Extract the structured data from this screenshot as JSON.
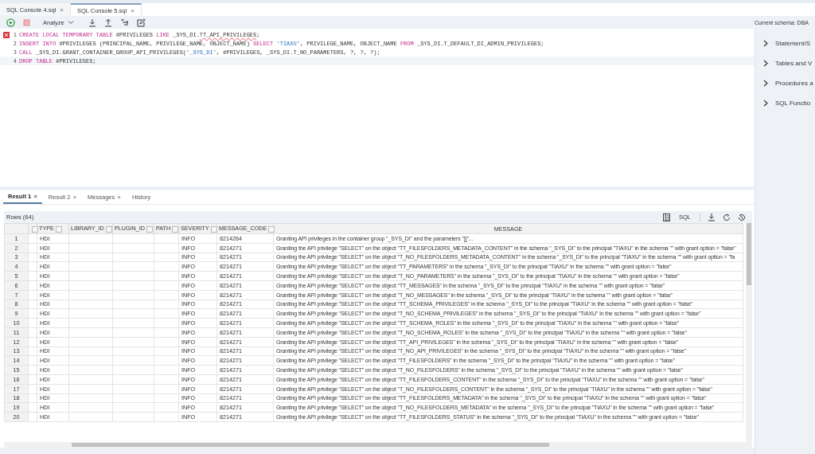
{
  "editor_tabs": [
    {
      "label": "SQL Console 4.sql",
      "close": "×",
      "selected": false
    },
    {
      "label": "SQL Console 5.sql",
      "close": "×",
      "selected": true
    }
  ],
  "toolbar": {
    "analyze": "Analyze",
    "current_schema": "Current schema: DBA"
  },
  "code_lines": [
    {
      "number": "1",
      "error": true,
      "current": false,
      "tokens": [
        {
          "kind": "keyword",
          "text": "CREATE LOCAL TEMPORARY TABLE"
        },
        {
          "kind": "text",
          "text": " #PRIVILEGES "
        },
        {
          "kind": "keyword",
          "text": "LIKE"
        },
        {
          "kind": "text",
          "text": " _SYS_DI."
        },
        {
          "kind": "flagged",
          "text": "TT_API_PRIVILEGES"
        },
        {
          "kind": "text",
          "text": ";"
        }
      ]
    },
    {
      "number": "2",
      "error": false,
      "current": false,
      "tokens": [
        {
          "kind": "keyword",
          "text": "INSERT INTO"
        },
        {
          "kind": "text",
          "text": " #PRIVILEGES (PRINCIPAL_NAME, PRIVILEGE_NAME, OBJECT_NAME) "
        },
        {
          "kind": "keyword",
          "text": "SELECT"
        },
        {
          "kind": "string",
          "text": " 'TIAXU'"
        },
        {
          "kind": "text",
          "text": ", PRIVILEGE_NAME, OBJECT_NAME "
        },
        {
          "kind": "keyword",
          "text": "FROM"
        },
        {
          "kind": "text",
          "text": " _SYS_DI.T_DEFAULT_DI_ADMIN_PRIVILEGES;"
        }
      ]
    },
    {
      "number": "3",
      "error": false,
      "current": false,
      "tokens": [
        {
          "kind": "keyword",
          "text": "CALL"
        },
        {
          "kind": "text",
          "text": " _SYS_DI.GRANT_CONTAINER_GROUP_API_PRIVILEGES("
        },
        {
          "kind": "string",
          "text": "'_SYS_DI'"
        },
        {
          "kind": "text",
          "text": ", #PRIVILEGES, _SYS_DI.T_NO_PARAMETERS, ?, ?, ?);"
        }
      ]
    },
    {
      "number": "4",
      "error": false,
      "current": true,
      "tokens": [
        {
          "kind": "keyword",
          "text": "DROP TABLE"
        },
        {
          "kind": "text",
          "text": " #PRIVILEGES;"
        }
      ]
    }
  ],
  "side_panel": [
    {
      "label": "Statement/S",
      "expanded": false
    },
    {
      "label": "Tables and V",
      "expanded": false
    },
    {
      "label": "Procedures a",
      "expanded": false
    },
    {
      "label": "SQL Functio",
      "expanded": false
    }
  ],
  "result_tabs": [
    {
      "label": "Result 1",
      "close": "×",
      "selected": true
    },
    {
      "label": "Result 2",
      "close": "×",
      "selected": false
    },
    {
      "label": "Messages",
      "close": "×",
      "selected": false
    },
    {
      "label": "History",
      "selected": false
    }
  ],
  "result": {
    "rows_label": "Rows (64)",
    "sql_button": "SQL",
    "columns": [
      "TYPE",
      "LIBRARY_ID",
      "PLUGIN_ID",
      "PATH",
      "SEVERITY",
      "MESSAGE_CODE",
      "MESSAGE"
    ],
    "rows": [
      {
        "n": "1",
        "type": "HDI",
        "severity": "INFO",
        "code": "8214264",
        "message": "Granting API privileges in the container group \"_SYS_DI\" and the parameters \"[]\"..."
      },
      {
        "n": "2",
        "type": "HDI",
        "severity": "INFO",
        "code": "8214271",
        "message": "Granting the API privilege \"SELECT\" on the object \"TT_FILESFOLDERS_METADATA_CONTENT\" in the schema \"_SYS_DI\" to the principal \"TIAXU\" in the schema \"\" with grant option = \"false\""
      },
      {
        "n": "3",
        "type": "HDI",
        "severity": "INFO",
        "code": "8214271",
        "message": "Granting the API privilege \"SELECT\" on the object \"T_NO_FILESFOLDERS_METADATA_CONTENT\" in the schema \"_SYS_DI\" to the principal \"TIAXU\" in the schema \"\" with grant option = \"fa"
      },
      {
        "n": "4",
        "type": "HDI",
        "severity": "INFO",
        "code": "8214271",
        "message": "Granting the API privilege \"SELECT\" on the object \"TT_PARAMETERS\" in the schema \"_SYS_DI\" to the principal \"TIAXU\" in the schema \"\" with grant option = \"false\""
      },
      {
        "n": "5",
        "type": "HDI",
        "severity": "INFO",
        "code": "8214271",
        "message": "Granting the API privilege \"SELECT\" on the object \"T_NO_PARAMETERS\" in the schema \"_SYS_DI\" to the principal \"TIAXU\" in the schema \"\" with grant option = \"false\""
      },
      {
        "n": "6",
        "type": "HDI",
        "severity": "INFO",
        "code": "8214271",
        "message": "Granting the API privilege \"SELECT\" on the object \"TT_MESSAGES\" in the schema \"_SYS_DI\" to the principal \"TIAXU\" in the schema \"\" with grant option = \"false\""
      },
      {
        "n": "7",
        "type": "HDI",
        "severity": "INFO",
        "code": "8214271",
        "message": "Granting the API privilege \"SELECT\" on the object \"T_NO_MESSAGES\" in the schema \"_SYS_DI\" to the principal \"TIAXU\" in the schema \"\" with grant option = \"false\""
      },
      {
        "n": "8",
        "type": "HDI",
        "severity": "INFO",
        "code": "8214271",
        "message": "Granting the API privilege \"SELECT\" on the object \"TT_SCHEMA_PRIVILEGES\" in the schema \"_SYS_DI\" to the principal \"TIAXU\" in the schema \"\" with grant option = \"false\""
      },
      {
        "n": "9",
        "type": "HDI",
        "severity": "INFO",
        "code": "8214271",
        "message": "Granting the API privilege \"SELECT\" on the object \"T_NO_SCHEMA_PRIVILEGES\" in the schema \"_SYS_DI\" to the principal \"TIAXU\" in the schema \"\" with grant option = \"false\""
      },
      {
        "n": "10",
        "type": "HDI",
        "severity": "INFO",
        "code": "8214271",
        "message": "Granting the API privilege \"SELECT\" on the object \"TT_SCHEMA_ROLES\" in the schema \"_SYS_DI\" to the principal \"TIAXU\" in the schema \"\" with grant option = \"false\""
      },
      {
        "n": "11",
        "type": "HDI",
        "severity": "INFO",
        "code": "8214271",
        "message": "Granting the API privilege \"SELECT\" on the object \"T_NO_SCHEMA_ROLES\" in the schema \"_SYS_DI\" to the principal \"TIAXU\" in the schema \"\" with grant option = \"false\""
      },
      {
        "n": "12",
        "type": "HDI",
        "severity": "INFO",
        "code": "8214271",
        "message": "Granting the API privilege \"SELECT\" on the object \"TT_API_PRIVILEGES\" in the schema \"_SYS_DI\" to the principal \"TIAXU\" in the schema \"\" with grant option = \"false\""
      },
      {
        "n": "13",
        "type": "HDI",
        "severity": "INFO",
        "code": "8214271",
        "message": "Granting the API privilege \"SELECT\" on the object \"T_NO_API_PRIVILEGES\" in the schema \"_SYS_DI\" to the principal \"TIAXU\" in the schema \"\" with grant option = \"false\""
      },
      {
        "n": "14",
        "type": "HDI",
        "severity": "INFO",
        "code": "8214271",
        "message": "Granting the API privilege \"SELECT\" on the object \"TT_FILESFOLDERS\" in the schema \"_SYS_DI\" to the principal \"TIAXU\" in the schema \"\" with grant option = \"false\""
      },
      {
        "n": "15",
        "type": "HDI",
        "severity": "INFO",
        "code": "8214271",
        "message": "Granting the API privilege \"SELECT\" on the object \"T_NO_FILESFOLDERS\" in the schema \"_SYS_DI\" to the principal \"TIAXU\" in the schema \"\" with grant option = \"false\""
      },
      {
        "n": "16",
        "type": "HDI",
        "severity": "INFO",
        "code": "8214271",
        "message": "Granting the API privilege \"SELECT\" on the object \"TT_FILESFOLDERS_CONTENT\" in the schema \"_SYS_DI\" to the principal \"TIAXU\" in the schema \"\" with grant option = \"false\""
      },
      {
        "n": "17",
        "type": "HDI",
        "severity": "INFO",
        "code": "8214271",
        "message": "Granting the API privilege \"SELECT\" on the object \"T_NO_FILESFOLDERS_CONTENT\" in the schema \"_SYS_DI\" to the principal \"TIAXU\" in the schema \"\" with grant option = \"false\""
      },
      {
        "n": "18",
        "type": "HDI",
        "severity": "INFO",
        "code": "8214271",
        "message": "Granting the API privilege \"SELECT\" on the object \"TT_FILESFOLDERS_METADATA\" in the schema \"_SYS_DI\" to the principal \"TIAXU\" in the schema \"\" with grant option = \"false\""
      },
      {
        "n": "19",
        "type": "HDI",
        "severity": "INFO",
        "code": "8214271",
        "message": "Granting the API privilege \"SELECT\" on the object \"T_NO_FILESFOLDERS_METADATA\" in the schema \"_SYS_DI\" to the principal \"TIAXU\" in the schema \"\" with grant option = \"false\""
      },
      {
        "n": "20",
        "type": "HDI",
        "severity": "INFO",
        "code": "8214271",
        "message": "Granting the API privilege \"SELECT\" on the object \"TT_FILESFOLDERS_STATUS\" in the schema \"_SYS_DI\" to the principal \"TIAXU\" in the schema \"\" with grant option = \"false\""
      }
    ]
  }
}
